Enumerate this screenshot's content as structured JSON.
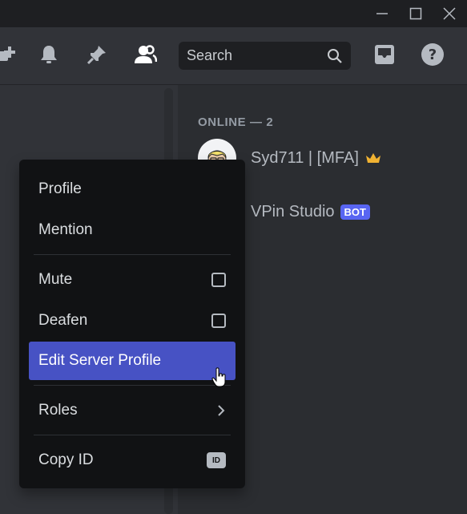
{
  "members": {
    "section_title": "ONLINE — 2",
    "items": [
      {
        "name": "Syd711 | [MFA]",
        "badge": "crown-icon"
      },
      {
        "name": "VPin Studio",
        "tag": "BOT"
      }
    ]
  },
  "header": {
    "search": {
      "placeholder": "Search"
    },
    "icons": [
      "threads-icon",
      "bell-icon",
      "pin-icon",
      "members-icon",
      "inbox-icon",
      "help-icon"
    ]
  },
  "context_menu": {
    "items": [
      {
        "label": "Profile"
      },
      {
        "label": "Mention"
      },
      {
        "label": "Mute",
        "control": "checkbox",
        "checked": false
      },
      {
        "label": "Deafen",
        "control": "checkbox",
        "checked": false
      },
      {
        "label": "Edit Server Profile",
        "highlighted": true
      },
      {
        "label": "Roles",
        "control": "chevron-right-icon"
      },
      {
        "label": "Copy ID",
        "control": "id-icon",
        "badge_text": "ID"
      }
    ]
  },
  "colors": {
    "accent": "#5865f2",
    "highlight": "#4752c4",
    "menu_bg": "#111214",
    "crown": "#f0b232"
  }
}
